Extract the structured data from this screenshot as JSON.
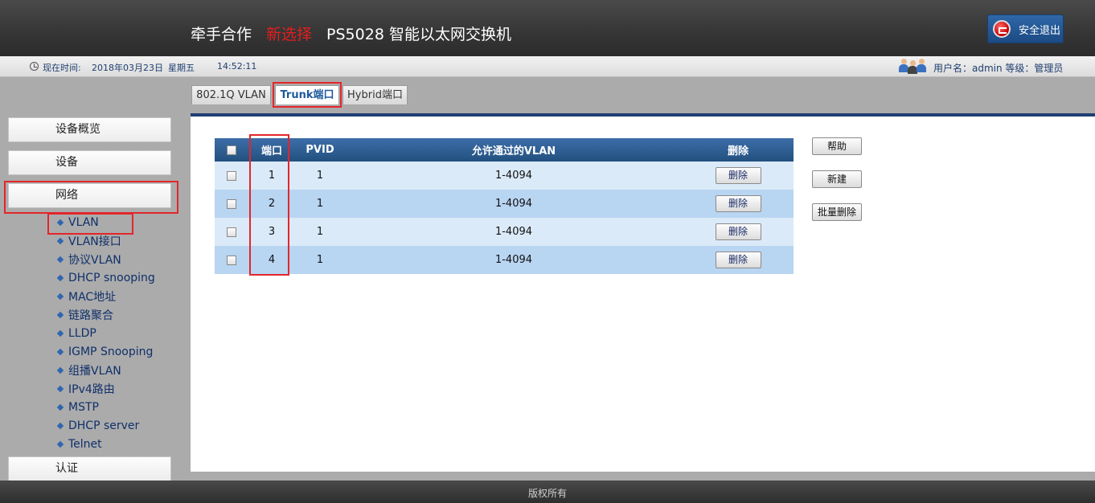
{
  "header": {
    "brand_part1": "牵手合作",
    "brand_part2": "新选择",
    "brand_part3": "PS5028 智能以太网交换机",
    "logout_label": "安全退出"
  },
  "infobar": {
    "time_label": "现在时间:",
    "date": "2018年03月23日",
    "weekday": "星期五",
    "time": "14:52:11",
    "user_info": "用户名：admin 等级：管理员"
  },
  "sidebar": {
    "items": [
      {
        "label": "设备概览"
      },
      {
        "label": "设备"
      },
      {
        "label": "网络"
      },
      {
        "label": "认证"
      }
    ],
    "network_submenu": [
      {
        "label": "VLAN"
      },
      {
        "label": "VLAN接口"
      },
      {
        "label": "协议VLAN"
      },
      {
        "label": "DHCP snooping"
      },
      {
        "label": "MAC地址"
      },
      {
        "label": "链路聚合"
      },
      {
        "label": "LLDP"
      },
      {
        "label": "IGMP Snooping"
      },
      {
        "label": "组播VLAN"
      },
      {
        "label": "IPv4路由"
      },
      {
        "label": "MSTP"
      },
      {
        "label": "DHCP server"
      },
      {
        "label": "Telnet"
      }
    ]
  },
  "tabs": [
    {
      "label": "802.1Q VLAN",
      "active": false
    },
    {
      "label": "Trunk端口",
      "active": true
    },
    {
      "label": "Hybrid端口",
      "active": false
    }
  ],
  "table": {
    "headers": {
      "port": "端口",
      "pvid": "PVID",
      "allowed_vlan": "允许通过的VLAN",
      "delete": "删除"
    },
    "rows": [
      {
        "port": "1",
        "pvid": "1",
        "allowed_vlan": "1-4094",
        "delete_label": "删除"
      },
      {
        "port": "2",
        "pvid": "1",
        "allowed_vlan": "1-4094",
        "delete_label": "删除"
      },
      {
        "port": "3",
        "pvid": "1",
        "allowed_vlan": "1-4094",
        "delete_label": "删除"
      },
      {
        "port": "4",
        "pvid": "1",
        "allowed_vlan": "1-4094",
        "delete_label": "删除"
      }
    ]
  },
  "actions": {
    "help": "帮助",
    "new": "新建",
    "batch_delete": "批量删除"
  },
  "footer": {
    "text": "版权所有"
  },
  "colors": {
    "highlight": "#e3262b",
    "brand_accent": "#e41e1e",
    "table_header": "#22507f",
    "row_light": "#dbeaf8",
    "row_dark": "#b8d5f2"
  }
}
